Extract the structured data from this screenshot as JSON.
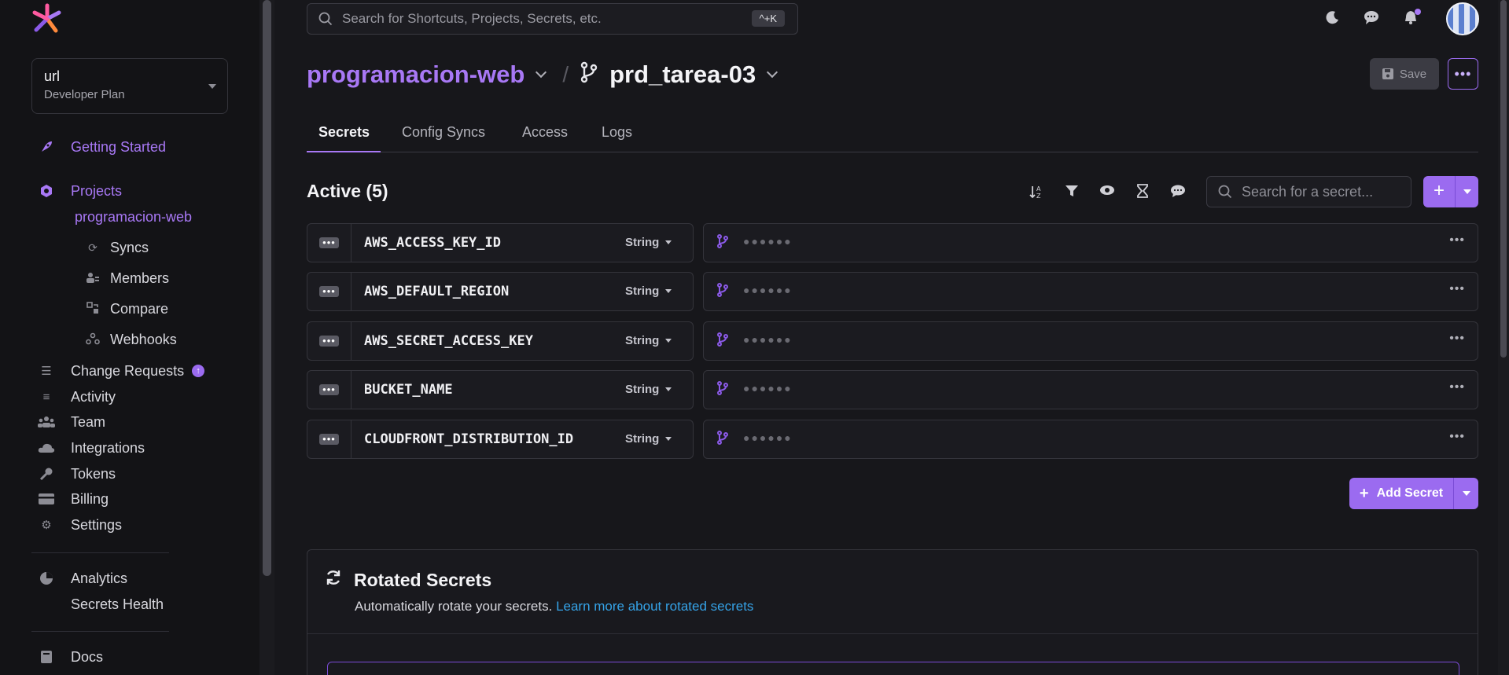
{
  "sidebar": {
    "org": {
      "name": "url",
      "plan": "Developer Plan"
    },
    "getting_started": "Getting Started",
    "projects": "Projects",
    "current_project": "programacion-web",
    "project_sub": [
      {
        "label": "Syncs",
        "icon": "sync-icon"
      },
      {
        "label": "Members",
        "icon": "members-icon"
      },
      {
        "label": "Compare",
        "icon": "compare-icon"
      },
      {
        "label": "Webhooks",
        "icon": "webhooks-icon"
      }
    ],
    "items": [
      {
        "label": "Change Requests",
        "icon": "change-requests-icon"
      },
      {
        "label": "Activity",
        "icon": "activity-icon"
      },
      {
        "label": "Team",
        "icon": "team-icon"
      },
      {
        "label": "Integrations",
        "icon": "cloud-icon"
      },
      {
        "label": "Tokens",
        "icon": "key-icon"
      },
      {
        "label": "Billing",
        "icon": "card-icon"
      },
      {
        "label": "Settings",
        "icon": "gear-icon"
      }
    ],
    "analytics": "Analytics",
    "secrets_health": "Secrets Health",
    "docs": "Docs"
  },
  "topbar": {
    "search_placeholder": "Search for Shortcuts, Projects, Secrets, etc.",
    "shortcut": "^+K"
  },
  "breadcrumb": {
    "project": "programacion-web",
    "separator": "/",
    "environment": "prd_tarea-03"
  },
  "actions": {
    "save": "Save"
  },
  "tabs": [
    "Secrets",
    "Config Syncs",
    "Access",
    "Logs"
  ],
  "secrets": {
    "title": "Active (5)",
    "search_placeholder": "Search for a secret...",
    "rows": [
      {
        "name": "AWS_ACCESS_KEY_ID",
        "type": "String",
        "value": "●●●●●●"
      },
      {
        "name": "AWS_DEFAULT_REGION",
        "type": "String",
        "value": "●●●●●●"
      },
      {
        "name": "AWS_SECRET_ACCESS_KEY",
        "type": "String",
        "value": "●●●●●●"
      },
      {
        "name": "BUCKET_NAME",
        "type": "String",
        "value": "●●●●●●"
      },
      {
        "name": "CLOUDFRONT_DISTRIBUTION_ID",
        "type": "String",
        "value": "●●●●●●"
      }
    ],
    "add_secret": "Add Secret"
  },
  "rotated": {
    "title": "Rotated Secrets",
    "description": "Automatically rotate your secrets.",
    "link": "Learn more about rotated secrets"
  },
  "colors": {
    "accent": "#9b6bf0",
    "link": "#35a3e8",
    "background": "#17171b"
  }
}
